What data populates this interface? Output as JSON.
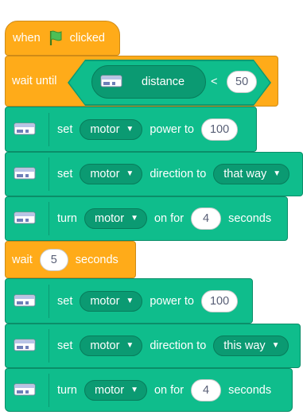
{
  "hat": {
    "when": "when",
    "flag_icon": "green-flag-icon",
    "clicked": "clicked"
  },
  "wait_until": {
    "label": "wait until",
    "sensor_name": "distance",
    "operator": "<",
    "value": "50"
  },
  "wait": {
    "label": "wait",
    "value": "5",
    "unit": "seconds"
  },
  "blocks": [
    {
      "kind": "set",
      "set": "set",
      "motor": "motor",
      "prop": "power to",
      "value": "100"
    },
    {
      "kind": "setdir",
      "set": "set",
      "motor": "motor",
      "prop": "direction to",
      "value": "that way"
    },
    {
      "kind": "turn",
      "turn": "turn",
      "motor": "motor",
      "on_for": "on for",
      "value": "4",
      "unit": "seconds"
    },
    {
      "kind": "set",
      "set": "set",
      "motor": "motor",
      "prop": "power to",
      "value": "100"
    },
    {
      "kind": "setdir",
      "set": "set",
      "motor": "motor",
      "prop": "direction to",
      "value": "this way"
    },
    {
      "kind": "turn",
      "turn": "turn",
      "motor": "motor",
      "on_for": "on for",
      "value": "4",
      "unit": "seconds"
    }
  ],
  "colors": {
    "events": "#ffab19",
    "control": "#ffab19",
    "extension": "#0fbd8c",
    "extension_dark": "#0b9a72"
  },
  "icons": {
    "extension": "wedo-hub-icon",
    "dropdown": "caret-down-icon",
    "flag": "green-flag-icon"
  }
}
